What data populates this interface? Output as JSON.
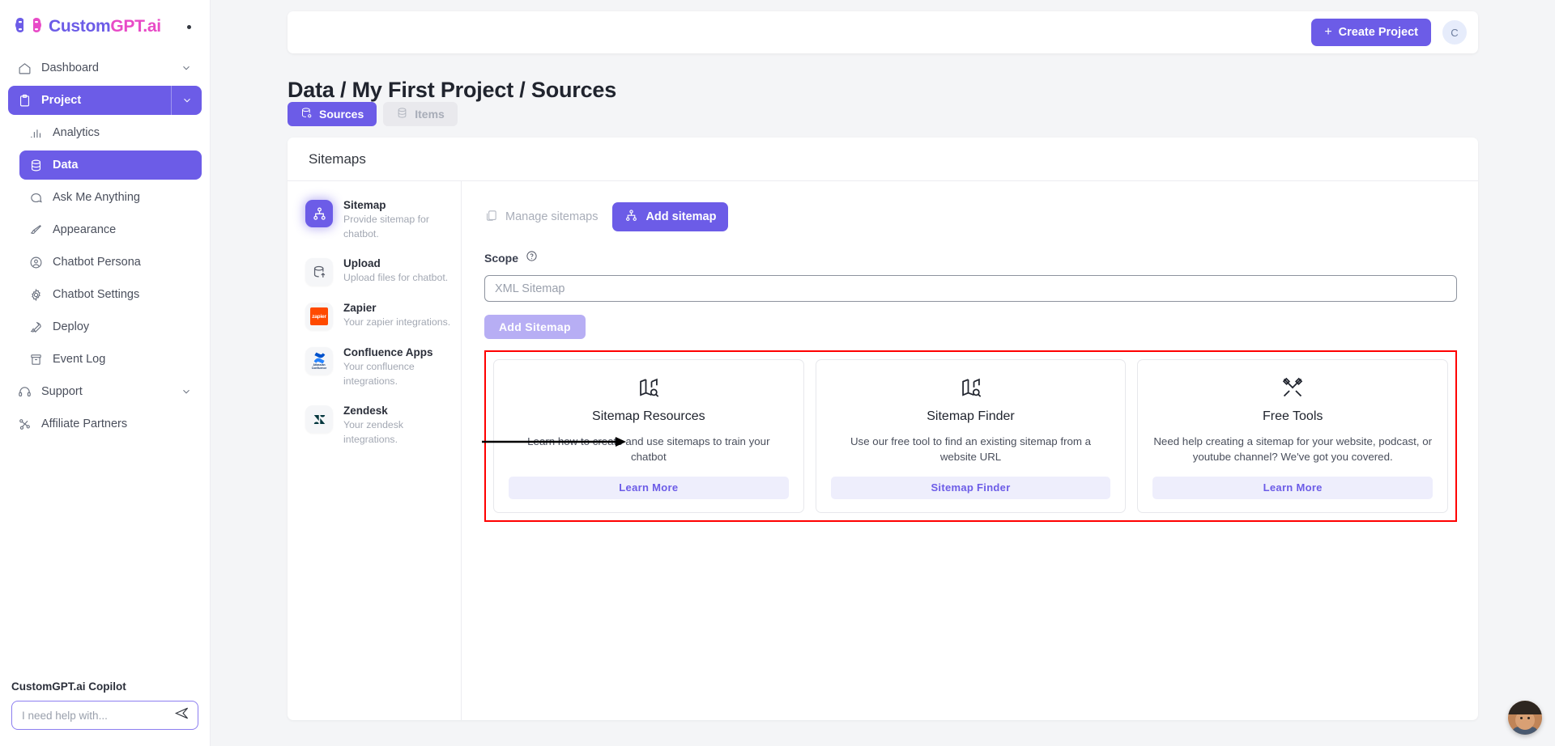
{
  "sidebar": {
    "brand": {
      "part1": "Custom",
      "part2": "GPT.ai"
    },
    "nav": [
      {
        "label": "Dashboard",
        "icon": "home-icon",
        "chevron": true
      },
      {
        "label": "Project",
        "icon": "clipboard-icon",
        "chevron": true,
        "state": "active-solid"
      },
      {
        "label": "Analytics",
        "icon": "bar-chart-icon"
      },
      {
        "label": "Data",
        "icon": "database-icon",
        "state": "active-flat"
      },
      {
        "label": "Ask Me Anything",
        "icon": "chat-icon"
      },
      {
        "label": "Appearance",
        "icon": "brush-icon"
      },
      {
        "label": "Chatbot Persona",
        "icon": "user-circle-icon"
      },
      {
        "label": "Chatbot Settings",
        "icon": "gear-icon"
      },
      {
        "label": "Deploy",
        "icon": "rocket-icon"
      },
      {
        "label": "Event Log",
        "icon": "archive-icon"
      },
      {
        "label": "Support",
        "icon": "headset-icon",
        "chevron": true
      },
      {
        "label": "Affiliate Partners",
        "icon": "share-nodes-icon"
      }
    ],
    "copilot": {
      "title": "CustomGPT.ai Copilot",
      "placeholder": "I need help with...",
      "value": "",
      "send_icon": "send-icon"
    }
  },
  "topbar": {
    "create_label": "Create Project",
    "create_icon": "plus-icon",
    "avatar_initial": "C"
  },
  "page": {
    "title": "Data / My First Project / Sources"
  },
  "tabs": [
    {
      "label": "Sources",
      "icon": "database-gear-icon",
      "active": true
    },
    {
      "label": "Items",
      "icon": "database-icon",
      "active": false
    }
  ],
  "card": {
    "heading": "Sitemaps"
  },
  "sources": [
    {
      "name": "Sitemap",
      "desc": "Provide sitemap for chatbot.",
      "icon": "sitemap-icon",
      "selected": true
    },
    {
      "name": "Upload",
      "desc": "Upload files for chatbot.",
      "icon": "database-upload-icon",
      "selected": false
    },
    {
      "name": "Zapier",
      "desc": "Your zapier integrations.",
      "icon": "zapier-logo-icon",
      "selected": false
    },
    {
      "name": "Confluence Apps",
      "desc": "Your confluence integrations.",
      "icon": "confluence-logo-icon",
      "selected": false
    },
    {
      "name": "Zendesk",
      "desc": "Your zendesk integrations.",
      "icon": "zendesk-logo-icon",
      "selected": false
    }
  ],
  "panel": {
    "manage_label": "Manage sitemaps",
    "manage_icon": "copy-icon",
    "add_label": "Add sitemap",
    "add_icon": "sitemap-icon",
    "scope_label": "Scope",
    "help_icon": "question-circle-icon",
    "scope_placeholder": "XML Sitemap",
    "scope_value": "",
    "submit_label": "Add Sitemap"
  },
  "promos": [
    {
      "title": "Sitemap Resources",
      "desc": "Learn how to create and use sitemaps to train your chatbot",
      "button": "Learn More",
      "icon": "map-search-icon"
    },
    {
      "title": "Sitemap Finder",
      "desc": "Use our free tool to find an existing sitemap from a website URL",
      "button": "Sitemap Finder",
      "icon": "map-search-icon"
    },
    {
      "title": "Free Tools",
      "desc": "Need help creating a sitemap for your website, podcast, or youtube channel? We've got you covered.",
      "button": "Learn More",
      "icon": "tools-icon"
    }
  ],
  "annotations": {
    "highlight_color": "#ff0000",
    "arrow_color": "#000000"
  },
  "colors": {
    "accent": "#6c5ce7",
    "accent_light": "#b7aef4",
    "brand_pink": "#e84bc7",
    "zapier_orange": "#ff4a00"
  }
}
